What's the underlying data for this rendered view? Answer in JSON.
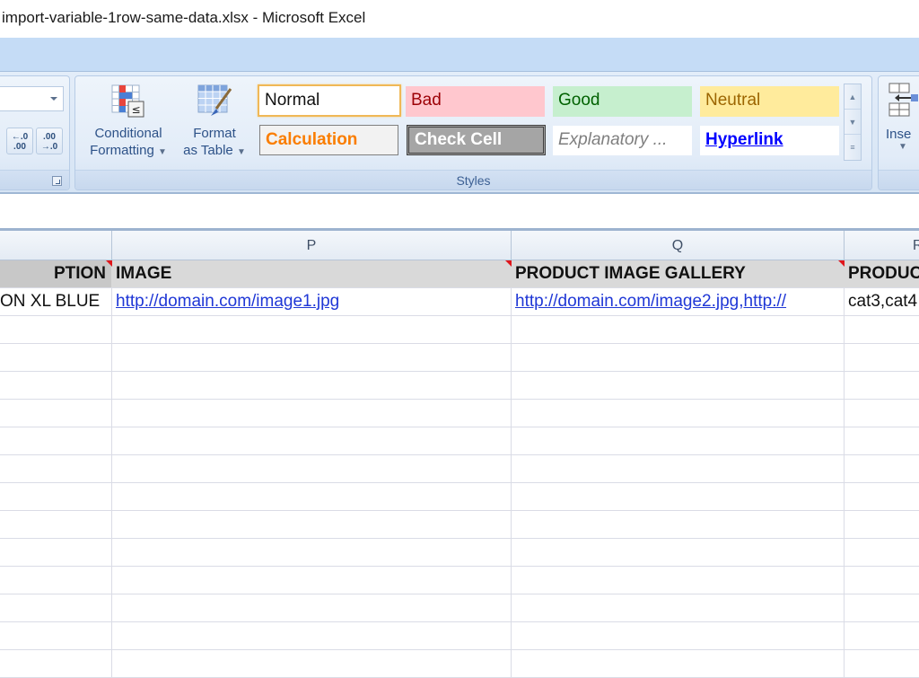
{
  "window": {
    "title": "import-variable-1row-same-data.xlsx  -  Microsoft Excel"
  },
  "ribbon": {
    "number_group": {
      "increase_decimal_label": "←.0\n.00",
      "decrease_decimal_label": ".00\n→.0"
    },
    "styles_group": {
      "label": "Styles",
      "conditional_formatting": {
        "line1": "Conditional",
        "line2": "Formatting"
      },
      "format_as_table": {
        "line1": "Format",
        "line2": "as Table"
      },
      "cell_styles": [
        {
          "name": "Normal"
        },
        {
          "name": "Bad"
        },
        {
          "name": "Good"
        },
        {
          "name": "Neutral"
        },
        {
          "name": "Calculation"
        },
        {
          "name": "Check Cell"
        },
        {
          "name": "Explanatory ..."
        },
        {
          "name": "Hyperlink"
        }
      ]
    },
    "cells_group": {
      "insert_label": "Inse"
    }
  },
  "sheet": {
    "columns": [
      {
        "letter": ""
      },
      {
        "letter": "P"
      },
      {
        "letter": "Q"
      },
      {
        "letter": "R"
      }
    ],
    "header_row": [
      "PTION",
      "IMAGE",
      "PRODUCT IMAGE GALLERY",
      "PRODUC"
    ],
    "data_row": [
      "ON XL BLUE",
      "http://domain.com/image1.jpg",
      "http://domain.com/image2.jpg,http://",
      "cat3,cat4"
    ]
  }
}
